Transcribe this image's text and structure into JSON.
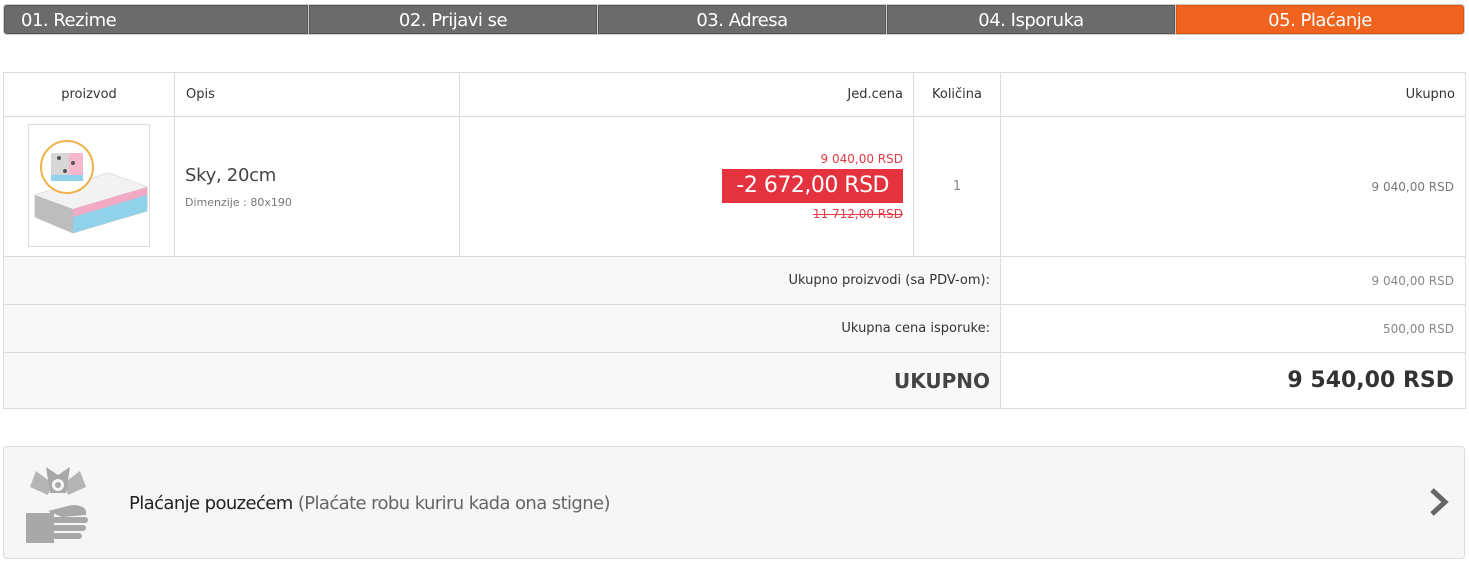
{
  "steps": [
    {
      "label": "01. Rezime",
      "active": false
    },
    {
      "label": "02. Prijavi se",
      "active": false
    },
    {
      "label": "03. Adresa",
      "active": false
    },
    {
      "label": "04. Isporuka",
      "active": false
    },
    {
      "label": "05. Plaćanje",
      "active": true
    }
  ],
  "table": {
    "headers": {
      "product": "proizvod",
      "description": "Opis",
      "unit_price": "Jed.cena",
      "quantity": "Količina",
      "total": "Ukupno"
    },
    "item": {
      "image_icon": "mattress-product-image",
      "name": "Sky, 20cm",
      "dimensions": "Dimenzije : 80x190",
      "price": "9 040,00 RSD",
      "discount": "-2 672,00 RSD",
      "original_price": "11 712,00 RSD",
      "quantity": "1",
      "total": "9 040,00 RSD"
    },
    "summary": {
      "products_label": "Ukupno proizvodi (sa PDV-om):",
      "products_value": "9 040,00 RSD",
      "shipping_label": "Ukupna cena isporuke:",
      "shipping_value": "500,00 RSD",
      "grand_label": "UKUPNO",
      "grand_value": "9 540,00 RSD"
    }
  },
  "payment": {
    "icon": "cash-in-hand-icon",
    "title": "Plaćanje pouzećem",
    "description": "(Plaćate robu kuriru kada ona stigne)",
    "arrow_icon": "chevron-right-icon"
  },
  "colors": {
    "active_step": "#f0631e",
    "inactive_step": "#6b6b6b",
    "discount": "#e5323f"
  }
}
